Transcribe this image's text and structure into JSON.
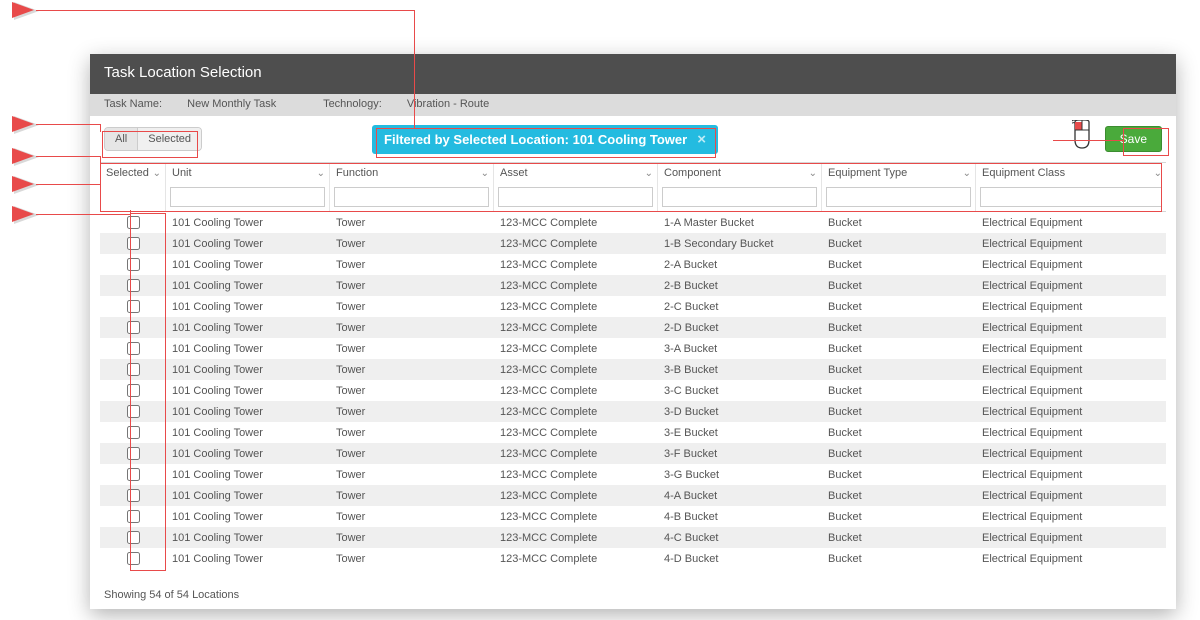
{
  "annotations": {
    "icon_color": "#e84a4a"
  },
  "title": "Task Location Selection",
  "info": {
    "task_name_label": "Task Name:",
    "task_name": "New Monthly Task",
    "technology_label": "Technology:",
    "technology": "Vibration - Route"
  },
  "toolbar": {
    "tab_all": "All",
    "tab_selected": "Selected",
    "filter_chip": "Filtered by Selected Location:  101 Cooling Tower",
    "save_label": "Save"
  },
  "columns": {
    "selected": "Selected",
    "unit": "Unit",
    "function": "Function",
    "asset": "Asset",
    "component": "Component",
    "equipment_type": "Equipment Type",
    "equipment_class": "Equipment Class"
  },
  "rows": [
    {
      "unit": "101 Cooling Tower",
      "function": "Tower",
      "asset": "123-MCC Complete",
      "component": "1-A Master Bucket",
      "equipment_type": "Bucket",
      "equipment_class": "Electrical Equipment"
    },
    {
      "unit": "101 Cooling Tower",
      "function": "Tower",
      "asset": "123-MCC Complete",
      "component": "1-B Secondary Bucket",
      "equipment_type": "Bucket",
      "equipment_class": "Electrical Equipment"
    },
    {
      "unit": "101 Cooling Tower",
      "function": "Tower",
      "asset": "123-MCC Complete",
      "component": "2-A Bucket",
      "equipment_type": "Bucket",
      "equipment_class": "Electrical Equipment"
    },
    {
      "unit": "101 Cooling Tower",
      "function": "Tower",
      "asset": "123-MCC Complete",
      "component": "2-B Bucket",
      "equipment_type": "Bucket",
      "equipment_class": "Electrical Equipment"
    },
    {
      "unit": "101 Cooling Tower",
      "function": "Tower",
      "asset": "123-MCC Complete",
      "component": "2-C Bucket",
      "equipment_type": "Bucket",
      "equipment_class": "Electrical Equipment"
    },
    {
      "unit": "101 Cooling Tower",
      "function": "Tower",
      "asset": "123-MCC Complete",
      "component": "2-D Bucket",
      "equipment_type": "Bucket",
      "equipment_class": "Electrical Equipment"
    },
    {
      "unit": "101 Cooling Tower",
      "function": "Tower",
      "asset": "123-MCC Complete",
      "component": "3-A Bucket",
      "equipment_type": "Bucket",
      "equipment_class": "Electrical Equipment"
    },
    {
      "unit": "101 Cooling Tower",
      "function": "Tower",
      "asset": "123-MCC Complete",
      "component": "3-B Bucket",
      "equipment_type": "Bucket",
      "equipment_class": "Electrical Equipment"
    },
    {
      "unit": "101 Cooling Tower",
      "function": "Tower",
      "asset": "123-MCC Complete",
      "component": "3-C Bucket",
      "equipment_type": "Bucket",
      "equipment_class": "Electrical Equipment"
    },
    {
      "unit": "101 Cooling Tower",
      "function": "Tower",
      "asset": "123-MCC Complete",
      "component": "3-D Bucket",
      "equipment_type": "Bucket",
      "equipment_class": "Electrical Equipment"
    },
    {
      "unit": "101 Cooling Tower",
      "function": "Tower",
      "asset": "123-MCC Complete",
      "component": "3-E Bucket",
      "equipment_type": "Bucket",
      "equipment_class": "Electrical Equipment"
    },
    {
      "unit": "101 Cooling Tower",
      "function": "Tower",
      "asset": "123-MCC Complete",
      "component": "3-F Bucket",
      "equipment_type": "Bucket",
      "equipment_class": "Electrical Equipment"
    },
    {
      "unit": "101 Cooling Tower",
      "function": "Tower",
      "asset": "123-MCC Complete",
      "component": "3-G Bucket",
      "equipment_type": "Bucket",
      "equipment_class": "Electrical Equipment"
    },
    {
      "unit": "101 Cooling Tower",
      "function": "Tower",
      "asset": "123-MCC Complete",
      "component": "4-A Bucket",
      "equipment_type": "Bucket",
      "equipment_class": "Electrical Equipment"
    },
    {
      "unit": "101 Cooling Tower",
      "function": "Tower",
      "asset": "123-MCC Complete",
      "component": "4-B Bucket",
      "equipment_type": "Bucket",
      "equipment_class": "Electrical Equipment"
    },
    {
      "unit": "101 Cooling Tower",
      "function": "Tower",
      "asset": "123-MCC Complete",
      "component": "4-C Bucket",
      "equipment_type": "Bucket",
      "equipment_class": "Electrical Equipment"
    },
    {
      "unit": "101 Cooling Tower",
      "function": "Tower",
      "asset": "123-MCC Complete",
      "component": "4-D Bucket",
      "equipment_type": "Bucket",
      "equipment_class": "Electrical Equipment"
    }
  ],
  "footer": "Showing 54 of 54 Locations"
}
